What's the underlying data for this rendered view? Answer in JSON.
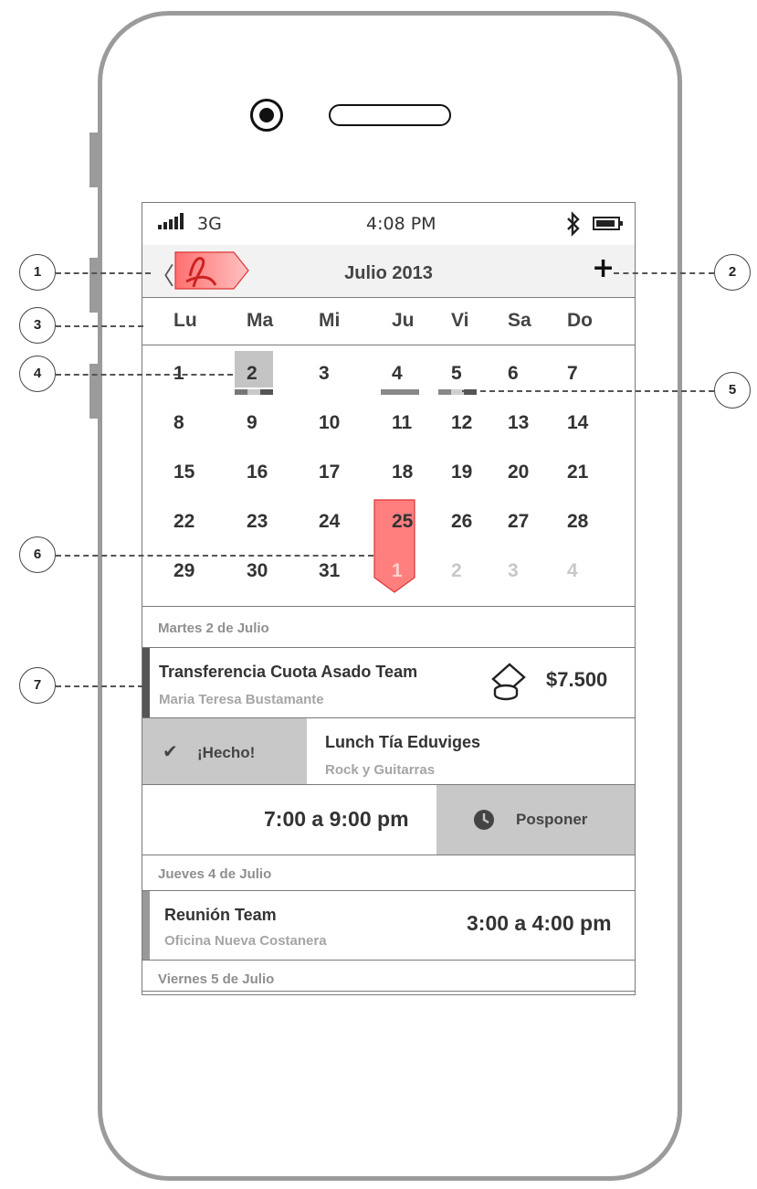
{
  "status_bar": {
    "network": "3G",
    "time": "4:08 PM",
    "bluetooth_icon": "bluetooth-icon",
    "battery_icon": "battery-icon"
  },
  "nav": {
    "back_icon": "back-chevron-icon",
    "title": "Julio 2013",
    "add_icon": "plus-icon"
  },
  "weekdays": [
    "Lu",
    "Ma",
    "Mi",
    "Ju",
    "Vi",
    "Sa",
    "Do"
  ],
  "calendar": {
    "weeks": [
      [
        "1",
        "2",
        "3",
        "4",
        "5",
        "6",
        "7"
      ],
      [
        "8",
        "9",
        "10",
        "11",
        "12",
        "13",
        "14"
      ],
      [
        "15",
        "16",
        "17",
        "18",
        "19",
        "20",
        "21"
      ],
      [
        "22",
        "23",
        "24",
        "25",
        "26",
        "27",
        "28"
      ],
      [
        "29",
        "30",
        "31",
        "1",
        "2",
        "3",
        "4"
      ]
    ],
    "selected_day": "2"
  },
  "agenda": {
    "section1_header": "Martes 2 de Julio",
    "event1": {
      "title": "Transferencia Cuota Asado Team",
      "subtitle": "Maria Teresa Bustamante",
      "amount": "$7.500",
      "icon": "money-icon"
    },
    "swipe_done": {
      "label": "¡Hecho!",
      "icon": "check-icon"
    },
    "event2": {
      "title": "Lunch Tía Eduviges",
      "subtitle": "Rock y Guitarras"
    },
    "event2_time": "7:00 a 9:00 pm",
    "postpone": {
      "label": "Posponer",
      "icon": "clock-icon"
    },
    "section2_header": "Jueves 4 de Julio",
    "event3": {
      "title": "Reunión Team",
      "subtitle": "Oficina Nueva Costanera",
      "time": "3:00 a 4:00 pm"
    },
    "section3_header": "Viernes 5 de Julio"
  },
  "annotations": [
    "1",
    "2",
    "3",
    "4",
    "5",
    "6",
    "7"
  ],
  "colors": {
    "annotation_red": "#ff7f7f",
    "selected_gray": "#c4c4c4",
    "action_gray": "#c8c8c8"
  }
}
